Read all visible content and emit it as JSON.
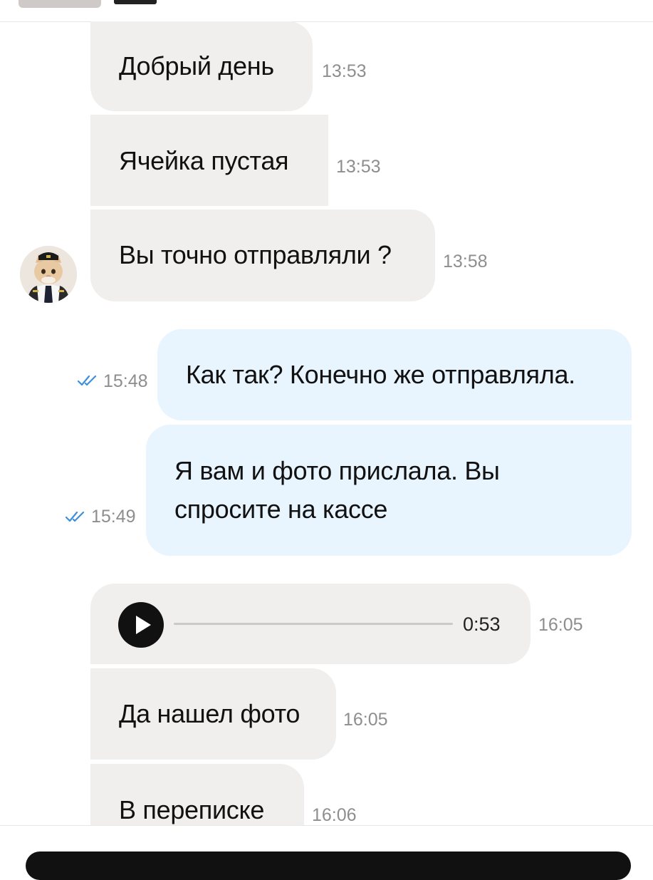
{
  "messages": [
    {
      "text": "Добрый день",
      "time": "13:53",
      "direction": "incoming"
    },
    {
      "text": "Ячейка пустая",
      "time": "13:53",
      "direction": "incoming"
    },
    {
      "text": "Вы точно отправляли ?",
      "time": "13:58",
      "direction": "incoming"
    },
    {
      "text": "Как так? Конечно же отправляла.",
      "time": "15:48",
      "direction": "outgoing",
      "read": true
    },
    {
      "text_line1": "Я вам и фото прислала. Вы",
      "text_line2": "спросите на кассе",
      "time": "15:49",
      "direction": "outgoing",
      "read": true
    },
    {
      "voice_duration": "0:53",
      "time": "16:05",
      "direction": "incoming"
    },
    {
      "text": "Да нашел фото",
      "time": "16:05",
      "direction": "incoming"
    },
    {
      "text": "В переписке",
      "time": "16:06",
      "direction": "incoming"
    }
  ],
  "icons": {
    "read_receipt": "double-check-icon",
    "voice_play": "play-icon",
    "avatar": "cat-pilot-avatar"
  },
  "colors": {
    "incoming_bubble": "#f0efee",
    "outgoing_bubble": "#e8f4fe",
    "read_check": "#3d8fdd",
    "timestamp": "#8e8e8e"
  }
}
